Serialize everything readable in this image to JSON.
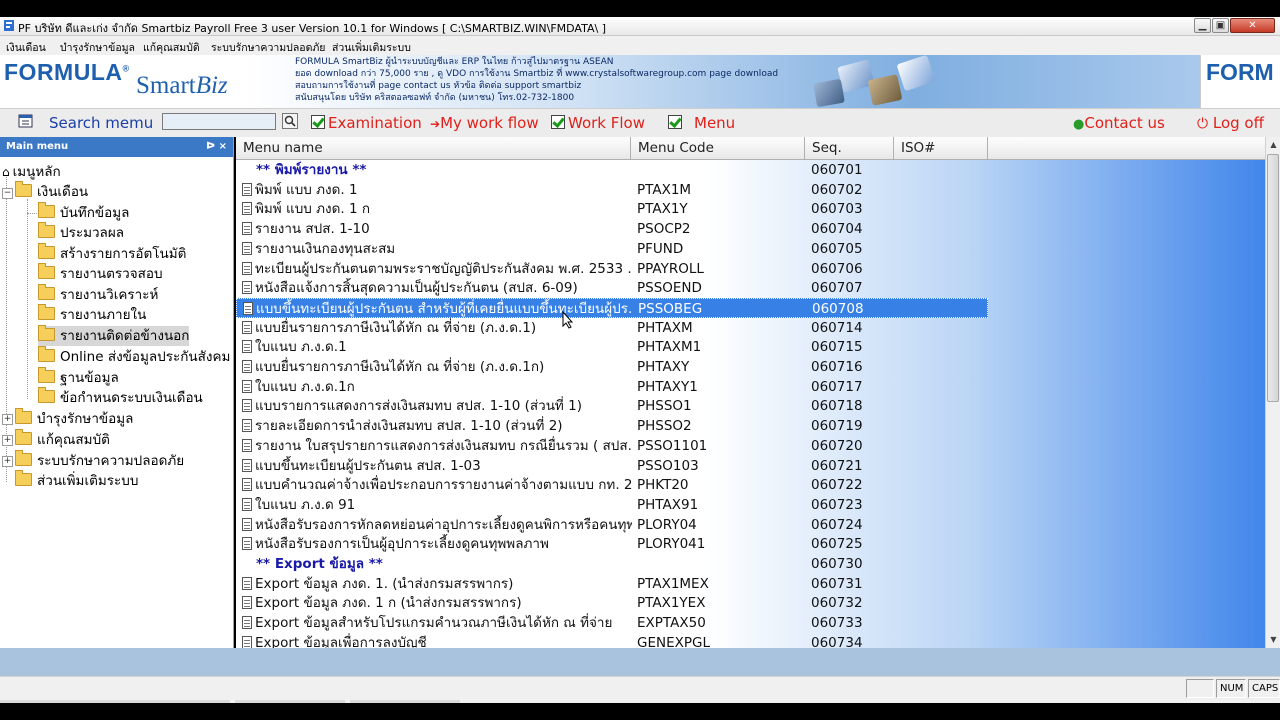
{
  "window": {
    "title": "PF บริษัท ดีและเก่ง จำกัด Smartbiz Payroll Free 3 user Version 10.1 for Windows [ C:\\SMARTBIZ.WIN\\FMDATA\\ ]"
  },
  "menubar": [
    "เงินเดือน",
    "บำรุงรักษาข้อมูล",
    "แก้คุณสมบัติ",
    "ระบบรักษาความปลอดภัย",
    "ส่วนเพิ่มเติมระบบ"
  ],
  "banner": {
    "logo_text": "FORMULA",
    "logo_sup": "®",
    "smart": "Smart",
    "biz": "Biz",
    "info_lines": [
      "FORMULA SmartBiz ผู้นำระบบบัญชีและ ERP ในไทย ก้าวสู่ไปมาตรฐาน ASEAN",
      "ยอด download กว่า 75,000 ราย , ดู VDO การใช้งาน Smartbiz ที่ www.crystalsoftwaregroup.com page download",
      "สอบถามการใช้งานที่ page contact us หัวข้อ ติดต่อ support smartbiz",
      "สนับสนุนโดย บริษัท คริสตอลซอฟท์ จำกัด (มหาชน) โทร.02-732-1800"
    ],
    "right_logo": "FORM"
  },
  "toolbar": {
    "search_label": "Search memu",
    "examination": "Examination",
    "workflow_mine": "My work flow",
    "workflow": "Work Flow",
    "menu": "Menu",
    "contact": "Contact us",
    "logoff": "Log off"
  },
  "sidebar": {
    "header": "Main menu",
    "pins": "ᐅ ×",
    "root": "เมนูหลัก",
    "nodes": [
      {
        "label": "เงินเดือน"
      },
      {
        "label": "บันทึกข้อมูล"
      },
      {
        "label": "ประมวลผล"
      },
      {
        "label": "สร้างรายการอัตโนมัติ"
      },
      {
        "label": "รายงานตรวจสอบ"
      },
      {
        "label": "รายงานวิเคราะห์"
      },
      {
        "label": "รายงานภายใน"
      },
      {
        "label": "รายงานติดต่อข้างนอก"
      },
      {
        "label": "Online ส่งข้อมูลประกันสังคม"
      },
      {
        "label": "ฐานข้อมูล"
      },
      {
        "label": "ข้อกำหนดระบบเงินเดือน"
      },
      {
        "label": "บำรุงรักษาข้อมูล"
      },
      {
        "label": "แก้คุณสมบัติ"
      },
      {
        "label": "ระบบรักษาความปลอดภัย"
      },
      {
        "label": "ส่วนเพิ่มเติมระบบ"
      }
    ]
  },
  "grid": {
    "columns": [
      "Menu name",
      "Menu Code",
      "Seq.",
      "ISO#"
    ],
    "rows": [
      {
        "name": "** พิมพ์รายงาน **",
        "code": "",
        "seq": "060701",
        "header": true
      },
      {
        "name": "พิมพ์ แบบ ภงด. 1",
        "code": "PTAX1M",
        "seq": "060702"
      },
      {
        "name": "พิมพ์ แบบ ภงด. 1 ก",
        "code": "PTAX1Y",
        "seq": "060703"
      },
      {
        "name": "รายงาน สปส. 1-10",
        "code": "PSOCP2",
        "seq": "060704"
      },
      {
        "name": "รายงานเงินกองทุนสะสม",
        "code": "PFUND",
        "seq": "060705"
      },
      {
        "name": "ทะเบียนผู้ประกันตนตามพระราชบัญญัติประกันสังคม พ.ศ. 2533 ...",
        "code": "PPAYROLL",
        "seq": "060706"
      },
      {
        "name": "หนังสือแจ้งการสิ้นสุดความเป็นผู้ประกันตน (สปส. 6-09)",
        "code": "PSSOEND",
        "seq": "060707"
      },
      {
        "name": "แบบขึ้นทะเบียนผู้ประกันตน สำหรับผู้ที่เคยยื่นแบบขึ้นทะเบียนผู้ปร...",
        "code": "PSSOBEG",
        "seq": "060708",
        "selected": true
      },
      {
        "name": "แบบยื่นรายการภาษีเงินได้หัก ณ ที่จ่าย (ภ.ง.ด.1)",
        "code": "PHTAXM",
        "seq": "060714"
      },
      {
        "name": "ใบแนบ ภ.ง.ด.1",
        "code": "PHTAXM1",
        "seq": "060715"
      },
      {
        "name": "แบบยื่นรายการภาษีเงินได้หัก ณ ที่จ่าย (ภ.ง.ด.1ก)",
        "code": "PHTAXY",
        "seq": "060716"
      },
      {
        "name": "ใบแนบ ภ.ง.ด.1ก",
        "code": "PHTAXY1",
        "seq": "060717"
      },
      {
        "name": "แบบรายการแสดงการส่งเงินสมทบ สปส. 1-10 (ส่วนที่ 1)",
        "code": "PHSSO1",
        "seq": "060718"
      },
      {
        "name": "รายละเอียดการนำส่งเงินสมทบ สปส. 1-10 (ส่วนที่ 2)",
        "code": "PHSSO2",
        "seq": "060719"
      },
      {
        "name": "รายงาน ใบสรุปรายการแสดงการส่งเงินสมทบ กรณียื่นรวม ( สปส....",
        "code": "PSSO1101",
        "seq": "060720"
      },
      {
        "name": "แบบขึ้นทะเบียนผู้ประกันตน สปส. 1-03",
        "code": "PSSO103",
        "seq": "060721"
      },
      {
        "name": "แบบคำนวณค่าจ้างเพื่อประกอบการรายงานค่าจ้างตามแบบ กท. 2...",
        "code": "PHKT20",
        "seq": "060722"
      },
      {
        "name": "ใบแนบ ภ.ง.ด 91",
        "code": "PHTAX91",
        "seq": "060723"
      },
      {
        "name": "หนังสือรับรองการหักลดหย่อนค่าอุปการะเลี้ยงดูคนพิการหรือคนทุพ...",
        "code": "PLORY04",
        "seq": "060724"
      },
      {
        "name": "หนังสือรับรองการเป็นผู้อุปการะเลี้ยงดูคนทุพพลภาพ",
        "code": "PLORY041",
        "seq": "060725"
      },
      {
        "name": "** Export ข้อมูล **",
        "code": "",
        "seq": "060730",
        "header": true
      },
      {
        "name": "Export ข้อมูล ภงด. 1. (นำส่งกรมสรรพากร)",
        "code": "PTAX1MEX",
        "seq": "060731"
      },
      {
        "name": "Export ข้อมูล ภงด. 1 ก (นำส่งกรมสรรพากร)",
        "code": "PTAX1YEX",
        "seq": "060732"
      },
      {
        "name": "Export ข้อมูลสำหรับโปรแกรมคำนวณภาษีเงินได้หัก ณ ที่จ่าย",
        "code": "EXPTAX50",
        "seq": "060733"
      },
      {
        "name": "Export ข้อมูลเพื่อการลงบัญชี",
        "code": "GENEXPGL",
        "seq": "060734"
      }
    ]
  },
  "statusbar": {
    "num": "NUM",
    "caps": "CAPS"
  },
  "colors": {
    "brand": "#1e5fae",
    "selection": "#3780e6",
    "toolbar_red": "#e0201a"
  }
}
